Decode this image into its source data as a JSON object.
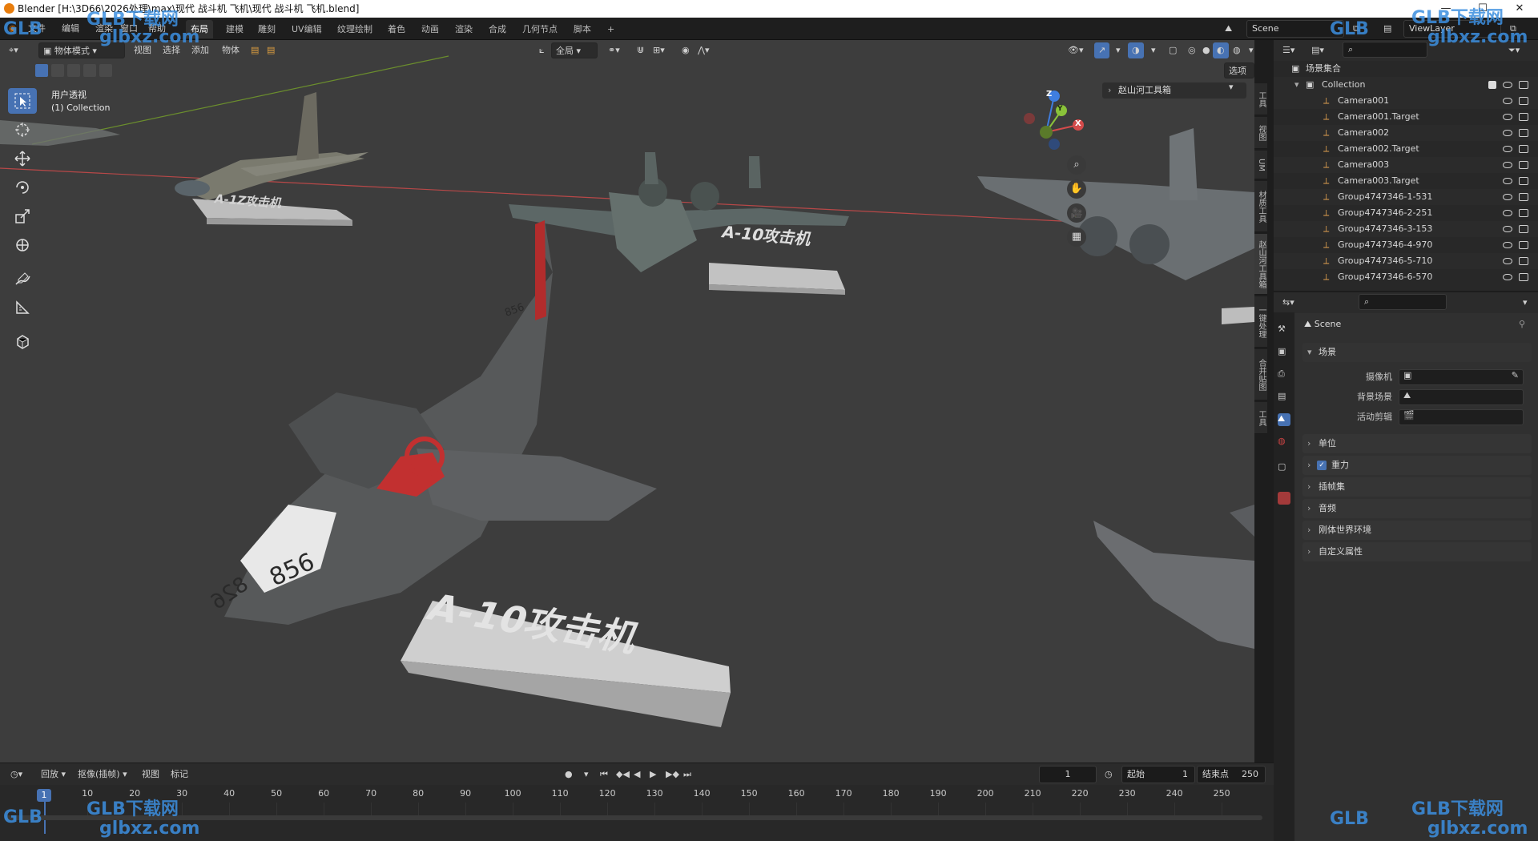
{
  "window": {
    "title": "Blender [H:\\3D66\\2026处理\\max\\现代 战斗机 飞机\\现代 战斗机 飞机.blend]",
    "controls": [
      "—",
      "☐",
      "✕"
    ]
  },
  "menu": [
    "文件",
    "编辑",
    "渲染",
    "窗口",
    "帮助"
  ],
  "workspaces": {
    "active": "布局",
    "tabs": [
      "布局",
      "建模",
      "雕刻",
      "UV编辑",
      "纹理绘制",
      "着色",
      "动画",
      "渲染",
      "合成",
      "几何节点",
      "脚本"
    ],
    "add": "+"
  },
  "scene_field": "Scene",
  "viewlayer_field": "ViewLayer",
  "viewport_header": {
    "mode": "物体模式",
    "menus": [
      "视图",
      "选择",
      "添加",
      "物体"
    ],
    "transform_orientation": "全局",
    "options": "选项"
  },
  "viewport_overlay": {
    "view_name": "用户透视",
    "collection_info": "(1) Collection",
    "tool_panel": "赵山河工具箱",
    "gizmo_axes": [
      "Z",
      "Y",
      "X"
    ]
  },
  "plane_labels": [
    "A-10攻击机",
    "A-10攻击机",
    "A-1Z攻击机"
  ],
  "tail_numbers": [
    "856",
    "856",
    "826"
  ],
  "side_tabs": [
    "工具",
    "视图",
    "UM",
    "材质工具",
    "赵山河工具箱",
    "一键处理",
    "合并贴图",
    "工具"
  ],
  "outliner": {
    "root": "场景集合",
    "collection": "Collection",
    "items": [
      "Camera001",
      "Camera001.Target",
      "Camera002",
      "Camera002.Target",
      "Camera003",
      "Camera003.Target",
      "Group4747346-1-531",
      "Group4747346-2-251",
      "Group4747346-3-153",
      "Group4747346-4-970",
      "Group4747346-5-710",
      "Group4747346-6-570"
    ]
  },
  "properties": {
    "context": "Scene",
    "panel_title": "场景",
    "fields": [
      {
        "label": "摄像机",
        "value": ""
      },
      {
        "label": "背景场景",
        "value": ""
      },
      {
        "label": "活动剪辑",
        "value": ""
      }
    ],
    "sections": [
      "单位",
      "重力",
      "插帧集",
      "音频",
      "刚体世界环境",
      "自定义属性"
    ],
    "gravity_checked": true
  },
  "timeline": {
    "menus": [
      "回放",
      "抠像(插帧)",
      "视图",
      "标记"
    ],
    "current_frame": "1",
    "start_label": "起始",
    "start_value": "1",
    "end_label": "结束点",
    "end_value": "250",
    "ticks": [
      "10",
      "20",
      "30",
      "40",
      "50",
      "60",
      "70",
      "80",
      "90",
      "100",
      "110",
      "120",
      "130",
      "140",
      "150",
      "160",
      "170",
      "180",
      "190",
      "200",
      "210",
      "220",
      "230",
      "240",
      "250"
    ],
    "playhead": "1"
  },
  "watermark": {
    "brand": "GLB下载网",
    "url": "glbxz.com",
    "logo": "GLB"
  },
  "colors": {
    "accent": "#4772b3",
    "viewport_bg": "#3d3d3d",
    "axis_x": "#d44b4b",
    "axis_y": "#8ac33a",
    "axis_z": "#3f7ee0"
  }
}
